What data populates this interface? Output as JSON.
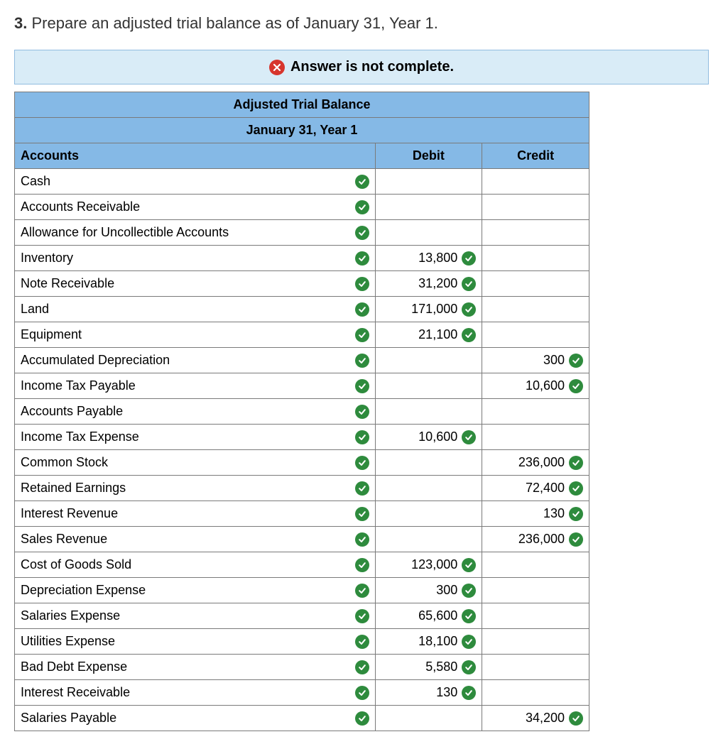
{
  "question": {
    "number": "3.",
    "text": "Prepare an adjusted trial balance as of January 31, Year 1."
  },
  "status": {
    "message": "Answer is not complete."
  },
  "table": {
    "title1": "Adjusted Trial Balance",
    "title2": "January 31, Year 1",
    "col_accounts": "Accounts",
    "col_debit": "Debit",
    "col_credit": "Credit",
    "rows": [
      {
        "account": "Cash",
        "account_ok": true,
        "debit": "",
        "debit_ok": false,
        "credit": "",
        "credit_ok": false
      },
      {
        "account": "Accounts Receivable",
        "account_ok": true,
        "debit": "",
        "debit_ok": false,
        "credit": "",
        "credit_ok": false
      },
      {
        "account": "Allowance for Uncollectible Accounts",
        "account_ok": true,
        "debit": "",
        "debit_ok": false,
        "credit": "",
        "credit_ok": false
      },
      {
        "account": "Inventory",
        "account_ok": true,
        "debit": "13,800",
        "debit_ok": true,
        "credit": "",
        "credit_ok": false
      },
      {
        "account": "Note Receivable",
        "account_ok": true,
        "debit": "31,200",
        "debit_ok": true,
        "credit": "",
        "credit_ok": false
      },
      {
        "account": "Land",
        "account_ok": true,
        "debit": "171,000",
        "debit_ok": true,
        "credit": "",
        "credit_ok": false
      },
      {
        "account": "Equipment",
        "account_ok": true,
        "debit": "21,100",
        "debit_ok": true,
        "credit": "",
        "credit_ok": false
      },
      {
        "account": "Accumulated Depreciation",
        "account_ok": true,
        "debit": "",
        "debit_ok": false,
        "credit": "300",
        "credit_ok": true
      },
      {
        "account": "Income Tax Payable",
        "account_ok": true,
        "debit": "",
        "debit_ok": false,
        "credit": "10,600",
        "credit_ok": true
      },
      {
        "account": "Accounts Payable",
        "account_ok": true,
        "debit": "",
        "debit_ok": false,
        "credit": "",
        "credit_ok": false
      },
      {
        "account": "Income Tax Expense",
        "account_ok": true,
        "debit": "10,600",
        "debit_ok": true,
        "credit": "",
        "credit_ok": false
      },
      {
        "account": "Common Stock",
        "account_ok": true,
        "debit": "",
        "debit_ok": false,
        "credit": "236,000",
        "credit_ok": true
      },
      {
        "account": "Retained Earnings",
        "account_ok": true,
        "debit": "",
        "debit_ok": false,
        "credit": "72,400",
        "credit_ok": true
      },
      {
        "account": "Interest Revenue",
        "account_ok": true,
        "debit": "",
        "debit_ok": false,
        "credit": "130",
        "credit_ok": true
      },
      {
        "account": "Sales Revenue",
        "account_ok": true,
        "debit": "",
        "debit_ok": false,
        "credit": "236,000",
        "credit_ok": true
      },
      {
        "account": "Cost of Goods Sold",
        "account_ok": true,
        "debit": "123,000",
        "debit_ok": true,
        "credit": "",
        "credit_ok": false
      },
      {
        "account": "Depreciation Expense",
        "account_ok": true,
        "debit": "300",
        "debit_ok": true,
        "credit": "",
        "credit_ok": false
      },
      {
        "account": "Salaries Expense",
        "account_ok": true,
        "debit": "65,600",
        "debit_ok": true,
        "credit": "",
        "credit_ok": false
      },
      {
        "account": "Utilities Expense",
        "account_ok": true,
        "debit": "18,100",
        "debit_ok": true,
        "credit": "",
        "credit_ok": false
      },
      {
        "account": "Bad Debt Expense",
        "account_ok": true,
        "debit": "5,580",
        "debit_ok": true,
        "credit": "",
        "credit_ok": false
      },
      {
        "account": "Interest Receivable",
        "account_ok": true,
        "debit": "130",
        "debit_ok": true,
        "credit": "",
        "credit_ok": false
      },
      {
        "account": "Salaries Payable",
        "account_ok": true,
        "debit": "",
        "debit_ok": false,
        "credit": "34,200",
        "credit_ok": true
      }
    ]
  }
}
